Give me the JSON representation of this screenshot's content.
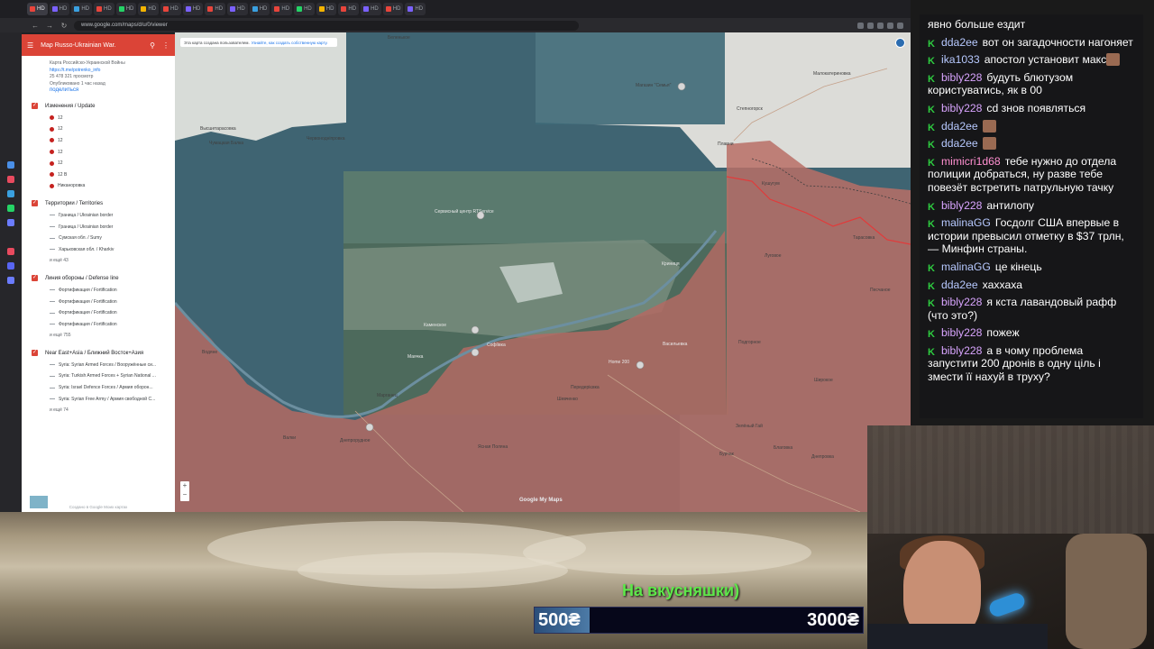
{
  "browser": {
    "url": "www.google.com/maps/d/u/0/viewer",
    "tabs": [
      "HD",
      "HD",
      "HD",
      "HD",
      "HD",
      "HD",
      "HD",
      "HD",
      "HD",
      "HD",
      "HD",
      "HD",
      "HD",
      "HD",
      "HD",
      "HD",
      "HD",
      "HD"
    ]
  },
  "panel": {
    "title": "Map Russo-Ukrainian War.",
    "subtitle": "Карта Российско-Украинской Войны",
    "link": "https://t.me/potrenko_info",
    "views": "25 478 321 просмотр",
    "published": "Опубликовано 1 час назад",
    "share": "поделиться",
    "footer": "Создано в Google Моих картах",
    "layers": [
      {
        "title": "Изменения / Update",
        "items": [
          "12",
          "12",
          "12",
          "12",
          "12",
          "12 В",
          "Никаноровка"
        ],
        "more": ""
      },
      {
        "title": "Территории / Territories",
        "items": [
          "Граница / Ukrainian border",
          "Граница / Ukrainian border",
          "Сумская обл. / Sumy",
          "Харьковская обл. / Kharkiv"
        ],
        "more": "и ещё 43"
      },
      {
        "title": "Линия обороны / Defense line",
        "items": [
          "Фортификация / Fortification",
          "Фортификация / Fortification",
          "Фортификация / Fortification",
          "Фортификация / Fortification"
        ],
        "more": "и ещё 755"
      },
      {
        "title": "Near East+Asia / Ближний Восток+Азия",
        "items": [
          "Syria: Syrian Armed Forces / Вооружённые си...",
          "Syria: Turkish Armed Forces + Syrian National ...",
          "Syria: Israel Defence Forces / Армия оборон...",
          "Syria: Syrian Free Army / Армия свободной С..."
        ],
        "more": "и ещё 74"
      }
    ]
  },
  "map": {
    "warning_text": "Эта карта создана пользователем.",
    "warning_link": "Узнайте, как создать собственную карту.",
    "watermark": "Google My Maps",
    "labels": {
      "belenkoe": "Беленькое",
      "vysshetarasovka": "Высшетарасовка",
      "ruvnaya_balka": "Чумацкая Балка",
      "chervonodneprovka": "Червонодніпровка",
      "magazin": "Магазин \"Семья\"",
      "stepnogorsk": "Степногорск",
      "plavni": "Плавни",
      "severny_center": "Сервисный центр RTService",
      "kamenskoe": "Каменское",
      "krinitsy": "Криниця",
      "mayachka": "Маячка",
      "sofievka": "Софіївка",
      "vasilyevka": "Васильевка",
      "nikopol_corner": "Червоний Яр",
      "podgornoe": "Подгорное",
      "perederedovka": "Передерієвка",
      "shevchenko": "Шевченко",
      "marganets": "Марганец",
      "dneprorudnoe": "Днепрорудное",
      "valki": "Валки",
      "yasnaya": "Ясная Поляна",
      "zelenogai": "Зелёный Гай",
      "blagovka": "Благовка",
      "buhtaya": "Бурчак",
      "dneprovka": "Днепровка",
      "lugovoe": "Луговое",
      "malokaterinovka": "Малокатериновка",
      "vodyane": "Водяне",
      "peschanoe": "Песчаное",
      "komyshuvakha": "Комишуваха",
      "lozovatka": "Лозоватка",
      "yuzhnoe": "Южное",
      "kushugum": "Кушугум",
      "shirokoe": "Широкое",
      "tarasovka": "Тарасовка",
      "home200": "Home 200"
    }
  },
  "chat": {
    "messages": [
      {
        "user": "",
        "text": "явно больше ездит",
        "color": "#ffffff",
        "emote": false,
        "continuation": true
      },
      {
        "user": "dda2ee",
        "text": "вот он загадочности нагоняет",
        "color": "#b7c9ff",
        "emote": false
      },
      {
        "user": "ika1033",
        "text": "апостол установит макс",
        "color": "#b7c9ff",
        "emote": true
      },
      {
        "user": "bibly228",
        "text": "будуть блютузом користуватись, як в 00",
        "color": "#d9a5ff",
        "emote": false
      },
      {
        "user": "bibly228",
        "text": "cd знов появляться",
        "color": "#d9a5ff",
        "emote": false
      },
      {
        "user": "dda2ee",
        "text": "",
        "color": "#b7c9ff",
        "emote": true
      },
      {
        "user": "dda2ee",
        "text": "",
        "color": "#b7c9ff",
        "emote": true
      },
      {
        "user": "mimicri1d68",
        "text": "тебе нужно до отдела полиции добраться, ну разве тебе повезёт встретить патрульную тачку",
        "color": "#ff8fd0",
        "emote": false
      },
      {
        "user": "bibly228",
        "text": "антилопу",
        "color": "#d9a5ff",
        "emote": false
      },
      {
        "user": "malinaGG",
        "text": "Госдолг США впервые в истории превысил отметку в $37 трлн, — Минфин страны.",
        "color": "#b7c9ff",
        "emote": false
      },
      {
        "user": "malinaGG",
        "text": "це кінець",
        "color": "#b7c9ff",
        "emote": false
      },
      {
        "user": "dda2ee",
        "text": "хаххаха",
        "color": "#b7c9ff",
        "emote": false
      },
      {
        "user": "bibly228",
        "text": "я кста лавандовый рафф (что это?)",
        "color": "#d9a5ff",
        "emote": false
      },
      {
        "user": "bibly228",
        "text": "пожеж",
        "color": "#d9a5ff",
        "emote": false
      },
      {
        "user": "bibly228",
        "text": "а в чому проблема запустити 200 дронів в одну ціль і змести її нахуй в труху?",
        "color": "#d9a5ff",
        "emote": false
      }
    ]
  },
  "donation": {
    "title": "На вкусняшки)",
    "current": "500₴",
    "target": "3000₴",
    "progress": 0.167
  },
  "colors": {
    "accent_red": "#db4437",
    "occupied_overlay": "#b36a63",
    "water": "#3f6472",
    "chat_badge": "#2ecc40",
    "goal_text": "#5ee84a"
  }
}
